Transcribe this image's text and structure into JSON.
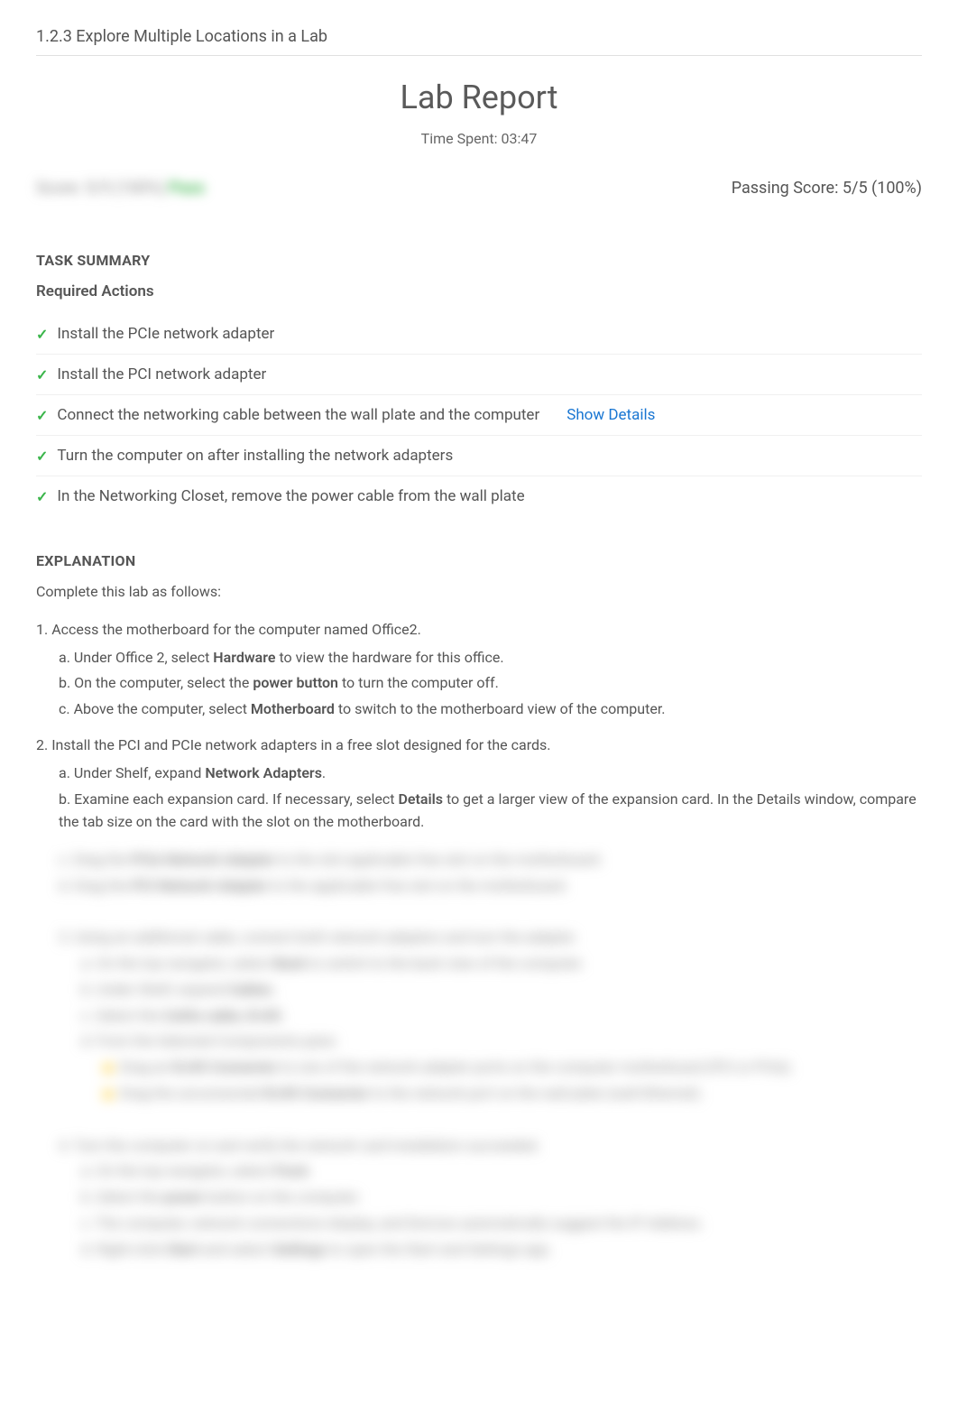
{
  "header": {
    "breadcrumb": "1.2.3 Explore Multiple Locations in a Lab"
  },
  "report": {
    "title": "Lab Report",
    "time_spent_label": "Time Spent: 03:47",
    "score_blurred": "Score: 5/5 (100%) Pass",
    "passing_score": "Passing Score: 5/5 (100%)"
  },
  "task_summary": {
    "title": "TASK SUMMARY",
    "required_title": "Required Actions",
    "actions": [
      {
        "text": "Install the PCIe network adapter",
        "details": false
      },
      {
        "text": "Install the PCI network adapter",
        "details": false
      },
      {
        "text": "Connect the networking cable between the wall plate and the computer",
        "details": true
      },
      {
        "text": "Turn the computer on after installing the network adapters",
        "details": false
      },
      {
        "text": "In the Networking Closet, remove the power cable from the wall plate",
        "details": false
      }
    ],
    "show_details_label": "Show Details"
  },
  "explanation": {
    "title": "EXPLANATION",
    "intro": "Complete this lab as follows:",
    "steps": [
      {
        "text": "Access the motherboard for the computer named Office2.",
        "substeps": [
          {
            "prefix": "Under Office 2, select ",
            "bold": "Hardware",
            "suffix": " to view the hardware for this office."
          },
          {
            "prefix": "On the computer, select the ",
            "bold": "power button",
            "suffix": " to turn the computer off."
          },
          {
            "prefix": "Above the computer, select ",
            "bold": "Motherboard",
            "suffix": " to switch to the motherboard view of the computer."
          }
        ]
      },
      {
        "text": "Install the PCI and PCIe network adapters in a free slot designed for the cards.",
        "substeps": [
          {
            "prefix": "Under Shelf, expand ",
            "bold": "Network Adapters",
            "suffix": "."
          },
          {
            "prefix": "Examine each expansion card. If necessary, select ",
            "bold": "Details",
            "suffix": " to get a larger view of the expansion card. In the Details window, compare the tab size on the card with the slot on the motherboard."
          }
        ]
      }
    ]
  }
}
